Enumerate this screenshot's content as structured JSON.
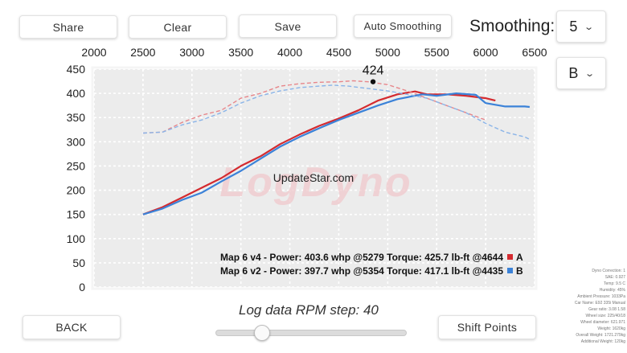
{
  "toolbar": {
    "share_label": "Share",
    "clear_label": "Clear",
    "save_label": "Save",
    "auto_smoothing_label": "Auto Smoothing",
    "smoothing_label": "Smoothing:",
    "smoothing_value": "5",
    "file_select_value": "B"
  },
  "chart_data": {
    "type": "line",
    "top_axis_ticks": [
      "2000",
      "2500",
      "3000",
      "3500",
      "4000",
      "4500",
      "5000",
      "5500",
      "6000",
      "6500"
    ],
    "left_axis_ticks": [
      "450",
      "400",
      "350",
      "300",
      "250",
      "200",
      "150",
      "100",
      "50",
      "0"
    ],
    "xlim": [
      2000,
      6500
    ],
    "ylim": [
      0,
      450
    ],
    "grid": true,
    "watermark": "LogDyno",
    "overlay_text": "UpdateStar.com",
    "peak_marker": {
      "label": "424",
      "x": 4850,
      "y": 424
    },
    "series": [
      {
        "name": "A",
        "kind": "power",
        "color": "#d42a2f",
        "dashed": false,
        "x": [
          2500,
          2700,
          2900,
          3100,
          3300,
          3500,
          3700,
          3900,
          4100,
          4300,
          4500,
          4700,
          4900,
          5100,
          5279,
          5400,
          5600,
          5800,
          6000,
          6100
        ],
        "y": [
          150,
          165,
          185,
          205,
          225,
          250,
          270,
          295,
          315,
          333,
          348,
          365,
          385,
          398,
          404,
          398,
          398,
          395,
          390,
          385
        ]
      },
      {
        "name": "A",
        "kind": "torque",
        "color": "#e7868a",
        "dashed": true,
        "x": [
          2500,
          2700,
          2900,
          3100,
          3300,
          3500,
          3700,
          3900,
          4100,
          4300,
          4500,
          4644,
          4800,
          5000,
          5200,
          5400,
          5600,
          5800,
          6000
        ],
        "y": [
          318,
          320,
          340,
          355,
          365,
          390,
          400,
          415,
          420,
          423,
          424,
          426,
          424,
          418,
          405,
          390,
          375,
          360,
          345
        ]
      },
      {
        "name": "B",
        "kind": "power",
        "color": "#3b82d8",
        "dashed": false,
        "x": [
          2500,
          2700,
          2900,
          3100,
          3300,
          3500,
          3700,
          3900,
          4100,
          4300,
          4500,
          4700,
          4900,
          5100,
          5354,
          5500,
          5700,
          5900,
          6000,
          6200,
          6400,
          6450
        ],
        "y": [
          150,
          162,
          180,
          195,
          218,
          240,
          265,
          290,
          310,
          328,
          345,
          360,
          375,
          388,
          398,
          395,
          400,
          397,
          380,
          373,
          373,
          372
        ]
      },
      {
        "name": "B",
        "kind": "torque",
        "color": "#8ab4e8",
        "dashed": true,
        "x": [
          2500,
          2700,
          2900,
          3100,
          3300,
          3500,
          3700,
          3900,
          4100,
          4300,
          4435,
          4600,
          4800,
          5000,
          5200,
          5400,
          5600,
          5800,
          6000,
          6200,
          6400,
          6450
        ],
        "y": [
          318,
          320,
          335,
          345,
          360,
          380,
          395,
          405,
          412,
          415,
          417,
          415,
          410,
          405,
          398,
          390,
          375,
          360,
          338,
          320,
          310,
          305
        ]
      }
    ],
    "legend": [
      {
        "text": "Map 6 v4 - Power: 403.6 whp @5279 Torque: 425.7 lb-ft @4644",
        "tag": "A",
        "color": "#d42a2f"
      },
      {
        "text": "Map 6 v2 - Power: 397.7 whp @5354 Torque: 417.1 lb-ft @4435",
        "tag": "B",
        "color": "#3b82d8"
      }
    ]
  },
  "rpm_step_label": "Log data RPM step: 40",
  "slider": {
    "value_fraction": 0.22
  },
  "bottom": {
    "back_label": "BACK",
    "shift_points_label": "Shift Points"
  },
  "info_panel": [
    "Dyno Correction: 1",
    "SAE: 0.927",
    "Temp: 9.5 C",
    "Humidity: 45%",
    "Ambient Pressure: 1033Pa",
    "Car Name: E92 335i Manual",
    "Gear ratio: 3.08 1.58",
    "Wheel size: 225/40/18",
    "Wheel diameter: 621.971",
    "Weight: 1620kg",
    "Overall Weight: 1721.279kg",
    "Additional Weight: 120kg"
  ]
}
